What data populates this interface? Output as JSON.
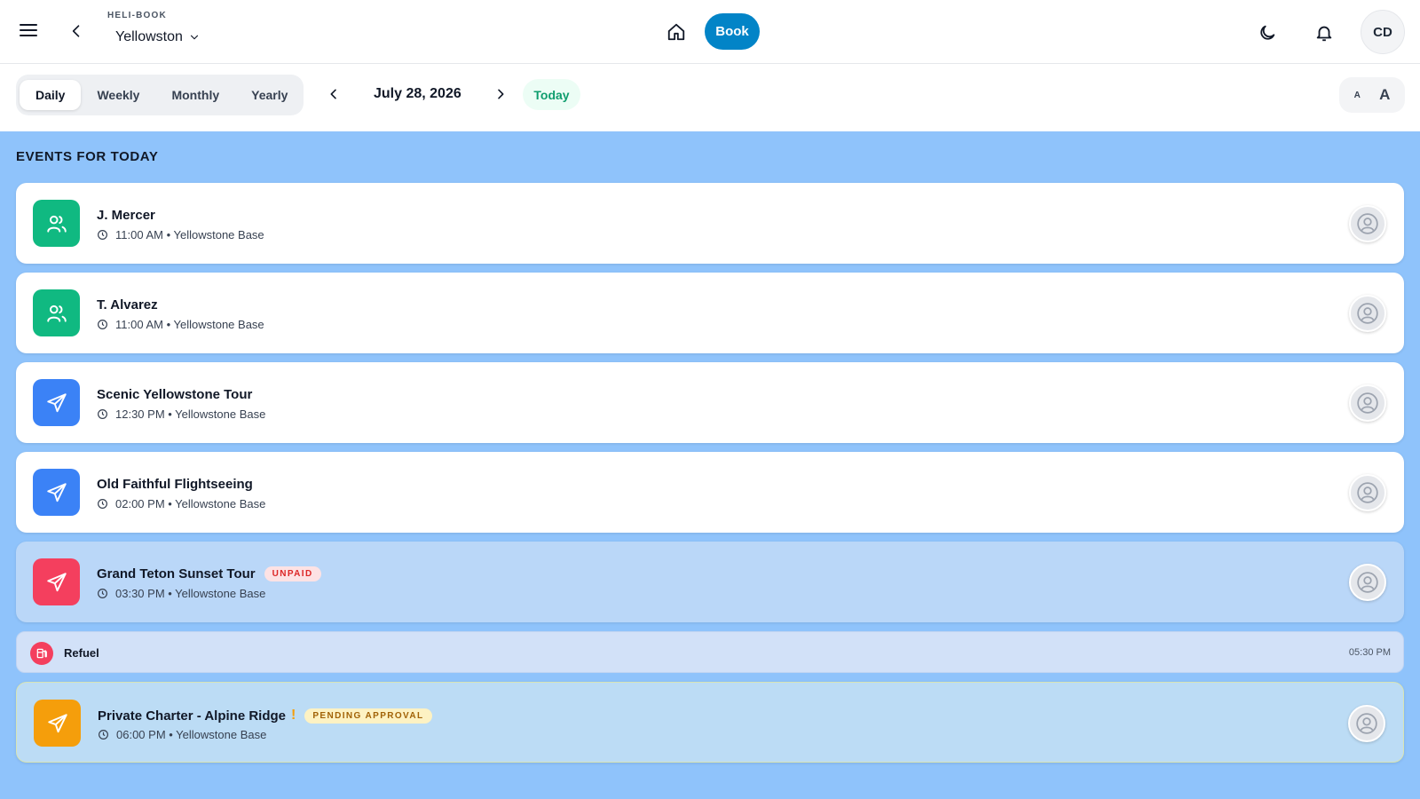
{
  "header": {
    "brand": "HELI-BOOK",
    "location": "Yellowston",
    "book_label": "Book",
    "user_initials": "CD"
  },
  "toolbar": {
    "views": [
      "Daily",
      "Weekly",
      "Monthly",
      "Yearly"
    ],
    "active_view": "Daily",
    "date": "July 28, 2026",
    "today_label": "Today",
    "font_small": "A",
    "font_large": "A"
  },
  "section": {
    "title": "EVENTS FOR TODAY"
  },
  "events": [
    {
      "title": "J. Mercer",
      "meta": "11:00 AM • Yellowstone Base",
      "icon": "users-icon",
      "color": "#10b981"
    },
    {
      "title": "T. Alvarez",
      "meta": "11:00 AM • Yellowstone Base",
      "icon": "users-icon",
      "color": "#10b981"
    },
    {
      "title": "Scenic Yellowstone Tour",
      "meta": "12:30 PM • Yellowstone Base",
      "icon": "plane-icon",
      "color": "#3b82f6"
    },
    {
      "title": "Old Faithful Flightseeing",
      "meta": "02:00 PM • Yellowstone Base",
      "icon": "plane-icon",
      "color": "#3b82f6"
    },
    {
      "title": "Grand Teton Sunset Tour",
      "meta": "03:30 PM • Yellowstone Base",
      "icon": "plane-icon",
      "color": "#f43f5e",
      "badge": "UNPAID"
    },
    {
      "title": "Private Charter - Alpine Ridge",
      "meta": "06:00 PM • Yellowstone Base",
      "icon": "plane-icon",
      "color": "#f59e0b",
      "badge": "PENDING APPROVAL",
      "flag": "!"
    }
  ],
  "refuel": {
    "title": "Refuel",
    "time": "05:30 PM",
    "icon": "fuel-icon",
    "color": "#f43f5e"
  }
}
